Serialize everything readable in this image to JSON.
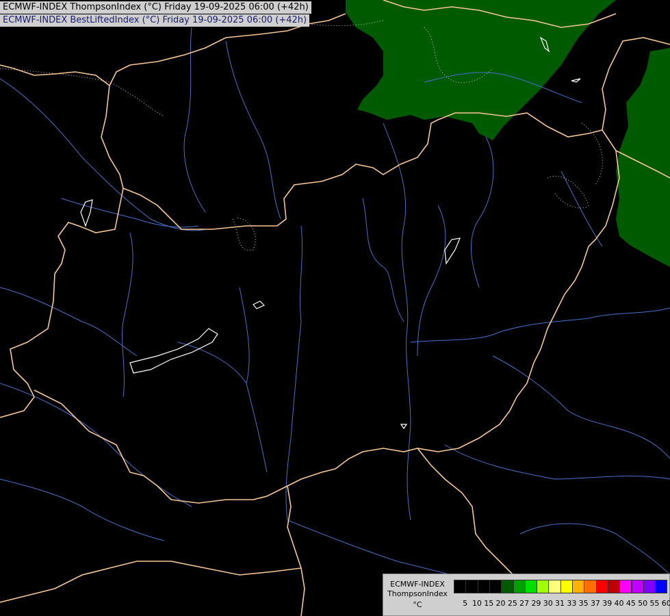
{
  "titles": {
    "line1": "ECMWF-INDEX ThompsonIndex (°C) Friday 19-09-2025 06:00 (+42h)",
    "line2": "ECMWF-INDEX BestLiftedIndex (°C) Friday 19-09-2025 06:00 (+42h)"
  },
  "legend": {
    "line1": "ECMWF-INDEX",
    "line2": "ThompsonIndex",
    "line3": "°C",
    "ticks": [
      "5",
      "10",
      "15",
      "20",
      "25",
      "27",
      "29",
      "30",
      "31",
      "33",
      "35",
      "37",
      "39",
      "40",
      "45",
      "50",
      "55",
      "60"
    ],
    "colors": [
      "#000000",
      "#000000",
      "#000000",
      "#000000",
      "#005a00",
      "#00a000",
      "#00e000",
      "#a0ff00",
      "#ffff80",
      "#ffff00",
      "#ffb000",
      "#ff7000",
      "#ff0000",
      "#c00000",
      "#ff00ff",
      "#c000ff",
      "#8000ff",
      "#0000ff"
    ]
  },
  "map": {
    "background": "#000000",
    "border_color": "#f5c896",
    "river_color": "#4a6fc8",
    "fill_color": "#005a00"
  }
}
